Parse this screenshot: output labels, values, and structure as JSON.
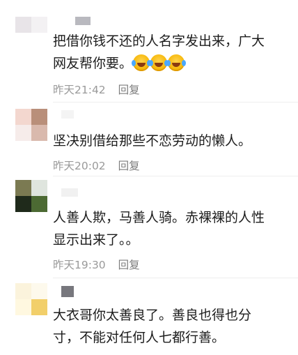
{
  "comments": [
    {
      "text_line1": "把借你钱不还的人名字发出来，广大",
      "text_line2": "网友帮你要。",
      "emoji_icons": [
        "laugh-cry-icon",
        "laugh-cry-icon",
        "laugh-cry-icon"
      ],
      "time": "昨天21:42",
      "reply_label": "回复"
    },
    {
      "text_line1": "坚决别借给那些不恋劳动的懒人。",
      "time": "昨天20:02",
      "reply_label": "回复"
    },
    {
      "text_line1": "人善人欺，马善人骑。赤裸裸的人性",
      "text_line2": "显示出来了。。",
      "time": "昨天19:30",
      "reply_label": "回复"
    },
    {
      "text_line1": "大衣哥你太善良了。善良也得也分",
      "text_line2": "寸，不能对任何人七都行善。"
    }
  ]
}
